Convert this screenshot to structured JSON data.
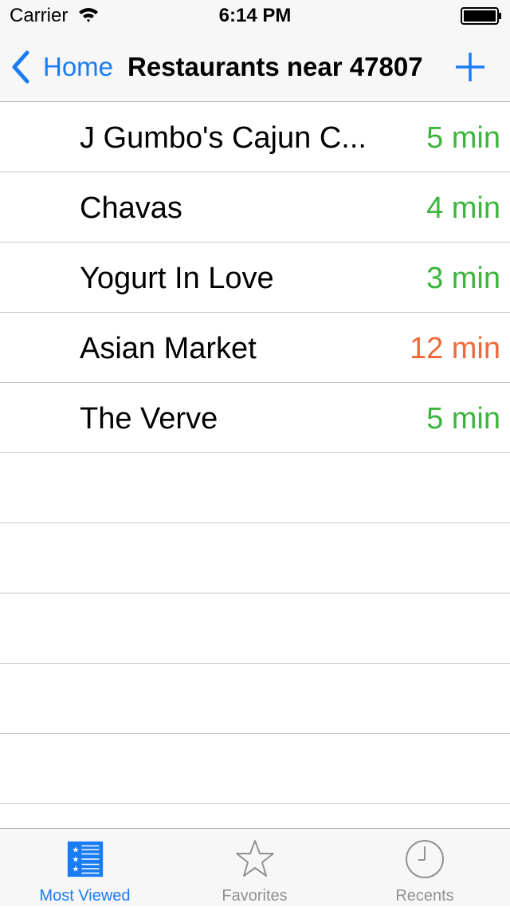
{
  "status_bar": {
    "carrier": "Carrier",
    "time": "6:14 PM"
  },
  "nav": {
    "back_label": "Home",
    "title": "Restaurants near 47807",
    "icons": {
      "back": "chevron-left-icon",
      "add": "plus-icon"
    }
  },
  "restaurants": [
    {
      "name": "J Gumbo's Cajun C...",
      "time": "5 min",
      "color": "#3bb53b"
    },
    {
      "name": "Chavas",
      "time": "4 min",
      "color": "#3bb53b"
    },
    {
      "name": "Yogurt In Love",
      "time": "3 min",
      "color": "#3bb53b"
    },
    {
      "name": "Asian Market",
      "time": "12 min",
      "color": "#f0683a"
    },
    {
      "name": "The Verve",
      "time": "5 min",
      "color": "#3bb53b"
    }
  ],
  "tabs": [
    {
      "label": "Most Viewed",
      "icon": "list-stars-icon",
      "selected": true
    },
    {
      "label": "Favorites",
      "icon": "star-icon",
      "selected": false
    },
    {
      "label": "Recents",
      "icon": "clock-icon",
      "selected": false
    }
  ],
  "colors": {
    "accent": "#1a7cf5",
    "inactive_tab": "#929292",
    "time_ok": "#3bb53b",
    "time_slow": "#f0683a"
  }
}
